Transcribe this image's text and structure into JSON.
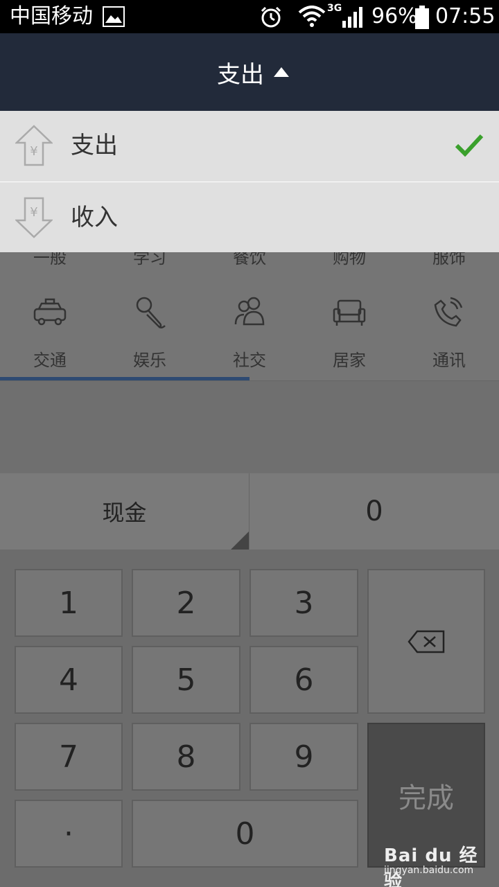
{
  "status_bar": {
    "carrier": "中国移动",
    "network": "3G",
    "battery": "96%",
    "time": "07:55"
  },
  "title_bar": {
    "title": "支出"
  },
  "dropdown": {
    "items": [
      {
        "label": "支出",
        "selected": true
      },
      {
        "label": "收入",
        "selected": false
      }
    ]
  },
  "categories": {
    "top_row": [
      "一般",
      "学习",
      "餐饮",
      "购物",
      "服饰"
    ],
    "items": [
      {
        "label": "交通",
        "icon": "car-icon"
      },
      {
        "label": "娱乐",
        "icon": "microphone-icon"
      },
      {
        "label": "社交",
        "icon": "people-icon"
      },
      {
        "label": "居家",
        "icon": "sofa-icon"
      },
      {
        "label": "通讯",
        "icon": "phone-icon"
      }
    ],
    "page": 1,
    "page_count": 2
  },
  "account": {
    "label": "现金",
    "amount": "0"
  },
  "keypad": {
    "keys": [
      "1",
      "2",
      "3",
      "4",
      "5",
      "6",
      "7",
      "8",
      "9",
      "·",
      "0"
    ],
    "done_label": "完成"
  },
  "watermark": {
    "logo": "Bai du 经验",
    "url": "jingyan.baidu.com"
  }
}
